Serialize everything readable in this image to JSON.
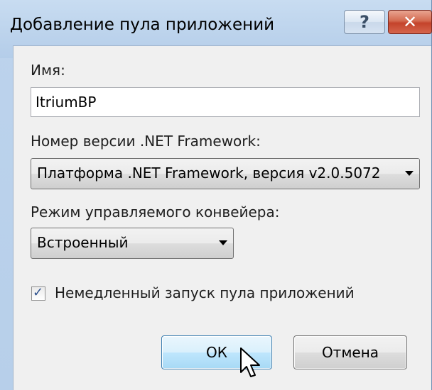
{
  "dialog": {
    "title": "Добавление пула приложений",
    "help_glyph": "?",
    "close_glyph": "✕"
  },
  "name_field": {
    "label": "Имя:",
    "value": "ItriumBP"
  },
  "framework": {
    "label": "Номер версии .NET Framework:",
    "selected": "Платформа .NET Framework, версия v2.0.5072"
  },
  "pipeline": {
    "label": "Режим управляемого конвейера:",
    "selected": "Встроенный"
  },
  "autostart": {
    "checked": true,
    "label": "Немедленный запуск пула приложений"
  },
  "buttons": {
    "ok_label": "ОК",
    "cancel_label": "Отмена"
  },
  "icons": {
    "help": "help-icon",
    "close": "close-icon",
    "dropdown": "chevron-down-icon",
    "check": "checkmark-icon",
    "cursor": "mouse-pointer-icon"
  },
  "colors": {
    "titlebar": "#c8dcf1",
    "close_button": "#c4432b",
    "default_button": "#bee6fd",
    "client_background": "#f0f0f0"
  }
}
